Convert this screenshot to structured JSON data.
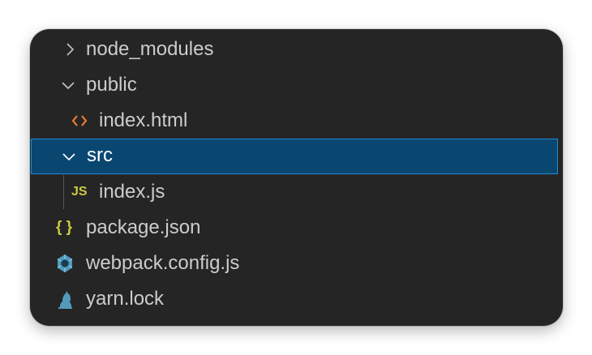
{
  "explorer": {
    "items": [
      {
        "label": "node_modules",
        "type": "folder",
        "state": "collapsed"
      },
      {
        "label": "public",
        "type": "folder",
        "state": "expanded"
      },
      {
        "label": "index.html",
        "type": "file",
        "icon": "html-icon"
      },
      {
        "label": "src",
        "type": "folder",
        "state": "expanded",
        "selected": true
      },
      {
        "label": "index.js",
        "type": "file",
        "icon": "js-icon",
        "icon_text": "JS"
      },
      {
        "label": "package.json",
        "type": "file",
        "icon": "json-icon",
        "icon_text": "{ }"
      },
      {
        "label": "webpack.config.js",
        "type": "file",
        "icon": "webpack-icon"
      },
      {
        "label": "yarn.lock",
        "type": "file",
        "icon": "yarn-icon"
      }
    ]
  },
  "colors": {
    "background": "#252526",
    "text": "#cccccc",
    "selection": "#094771",
    "selection_border": "#1f8ad6",
    "html_icon": "#e37933",
    "js_icon": "#cbcb41",
    "json_icon": "#cbcb41",
    "webpack_icon": "#519aba",
    "yarn_icon": "#519aba"
  }
}
